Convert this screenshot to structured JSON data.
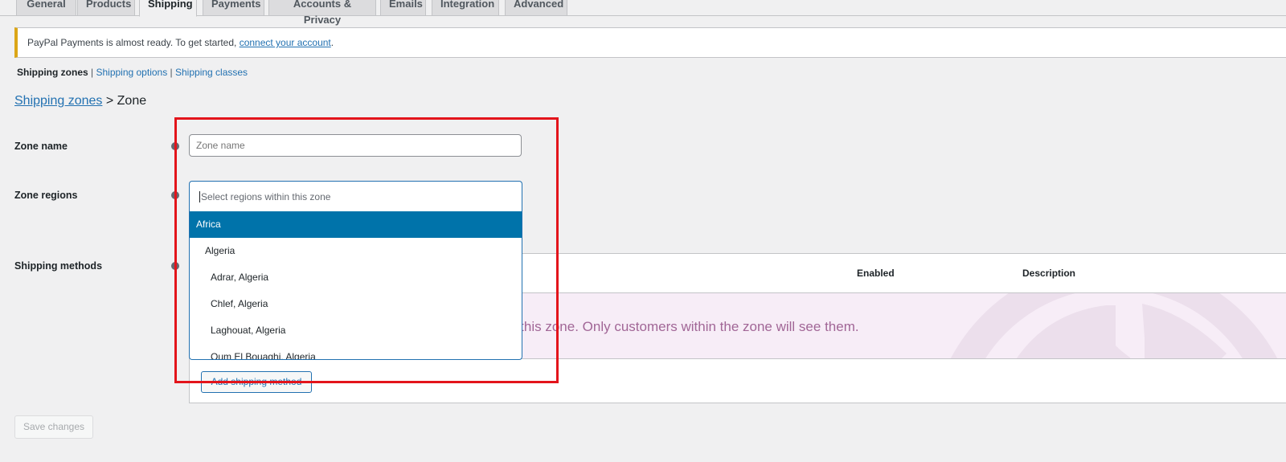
{
  "tabs": [
    {
      "label": "General",
      "active": false
    },
    {
      "label": "Products",
      "active": false
    },
    {
      "label": "Shipping",
      "active": true
    },
    {
      "label": "Payments",
      "active": false
    },
    {
      "label": "Accounts & Privacy",
      "active": false
    },
    {
      "label": "Emails",
      "active": false
    },
    {
      "label": "Integration",
      "active": false
    },
    {
      "label": "Advanced",
      "active": false
    }
  ],
  "notice": {
    "text": "PayPal Payments is almost ready. To get started, ",
    "link": "connect your account",
    "suffix": ".",
    "accent_color": "#dba617"
  },
  "subnav": {
    "current": "Shipping zones",
    "separator": " | ",
    "links": [
      "Shipping options",
      "Shipping classes"
    ]
  },
  "breadcrumb": {
    "link": "Shipping zones",
    "separator": " > ",
    "current": "Zone"
  },
  "form": {
    "zone_name": {
      "label": "Zone name",
      "value": "",
      "placeholder": "Zone name"
    },
    "zone_regions": {
      "label": "Zone regions",
      "placeholder": "Select regions within this zone",
      "options": [
        {
          "label": "Africa",
          "level": 0,
          "highlighted": true
        },
        {
          "label": "Algeria",
          "level": 1,
          "highlighted": false
        },
        {
          "label": "Adrar, Algeria",
          "level": 2,
          "highlighted": false
        },
        {
          "label": "Chlef, Algeria",
          "level": 2,
          "highlighted": false
        },
        {
          "label": "Laghouat, Algeria",
          "level": 2,
          "highlighted": false
        },
        {
          "label": "Oum El Bouaghi, Algeria",
          "level": 2,
          "highlighted": false
        }
      ]
    },
    "shipping_methods": {
      "label": "Shipping methods",
      "columns": [
        "Enabled",
        "Description"
      ],
      "blank_state": "n this zone. Only customers within the zone will see them.",
      "add_button": "Add shipping method"
    }
  },
  "save_button": "Save changes",
  "colors": {
    "primary": "#2271b1",
    "highlight": "#0073aa",
    "blank_state_bg": "#f7edf7",
    "blank_state_text": "#a16696",
    "annotation": "#e3141b"
  }
}
